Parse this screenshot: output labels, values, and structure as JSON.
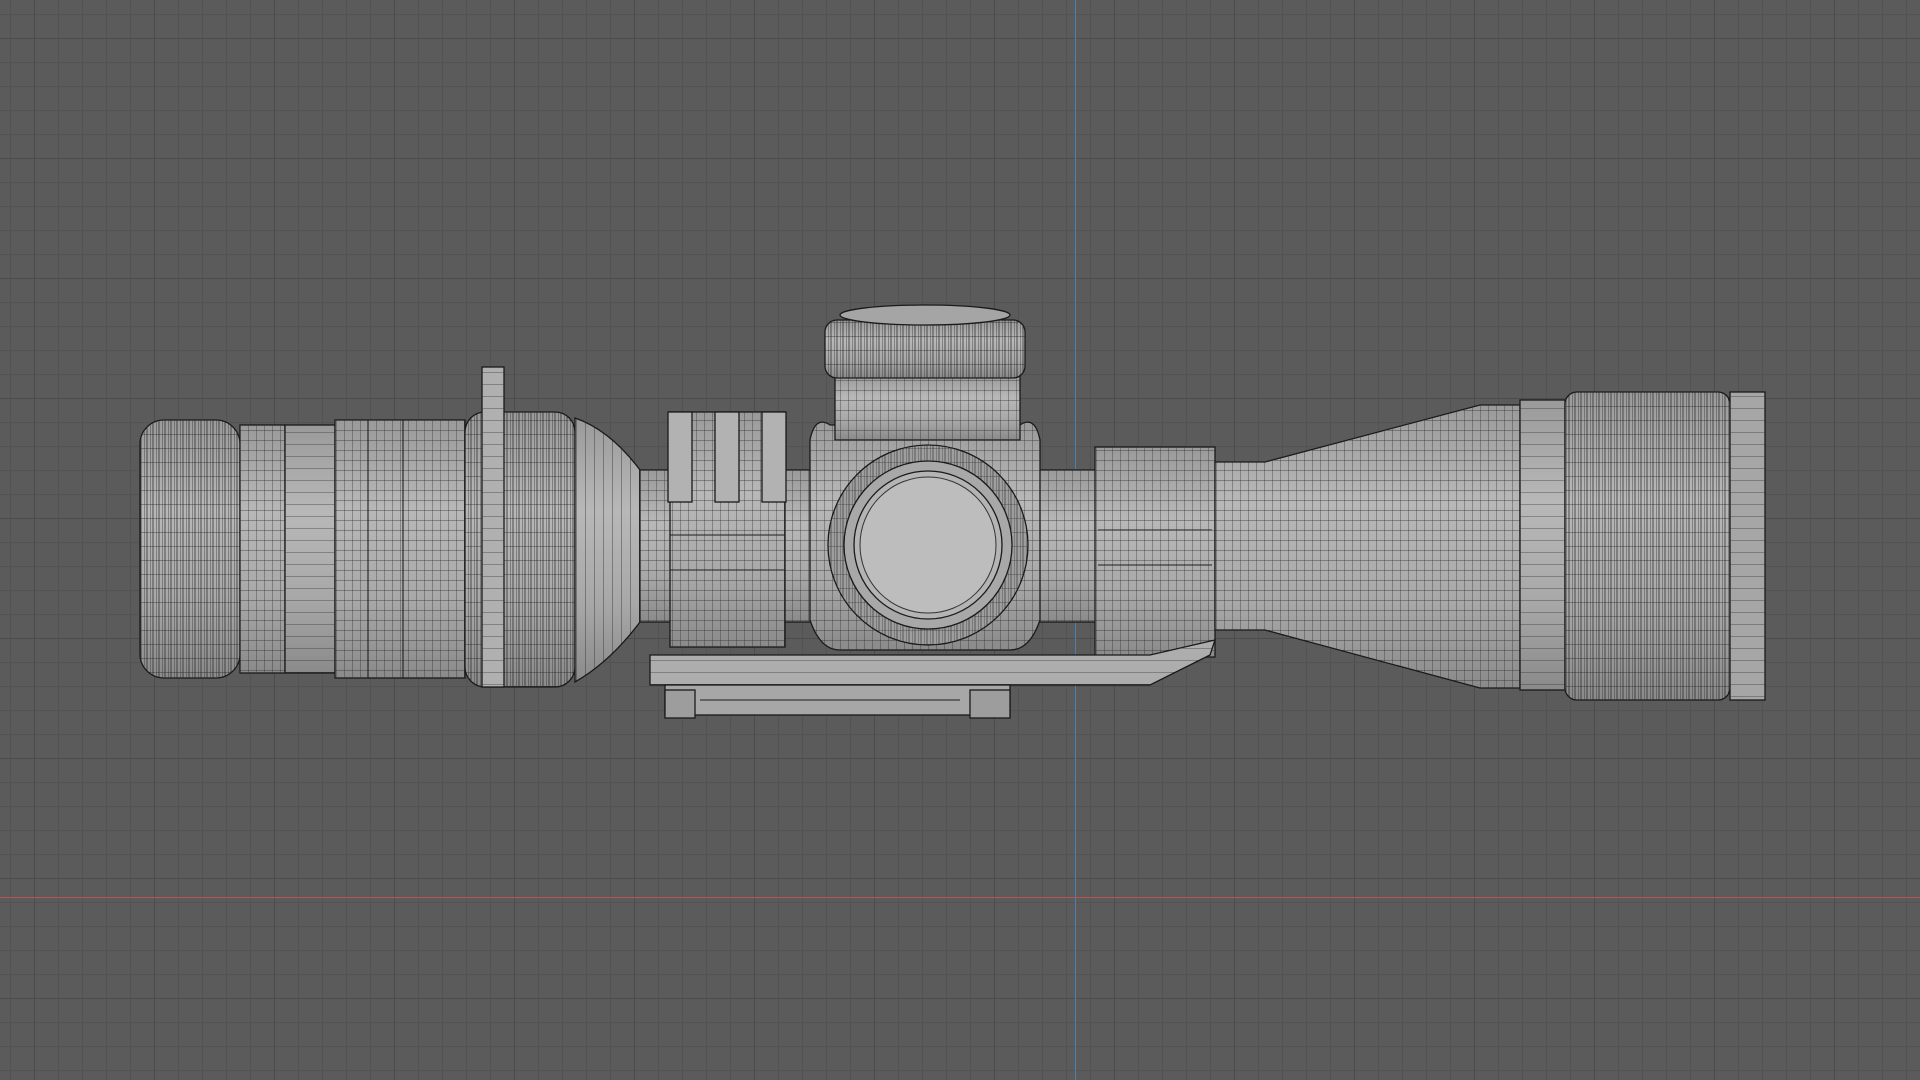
{
  "viewport": {
    "background": "#5b5b5b",
    "grid_major": "#4c4c4c",
    "grid_minor": "#535353",
    "axis_x_color": "#b45656",
    "axis_y_color": "#4a7fae",
    "mesh_fill": "#a9a9a9",
    "mesh_wire": "#1e1e1e"
  },
  "model": {
    "object": "rifle-scope-wireframe",
    "view": "side"
  }
}
